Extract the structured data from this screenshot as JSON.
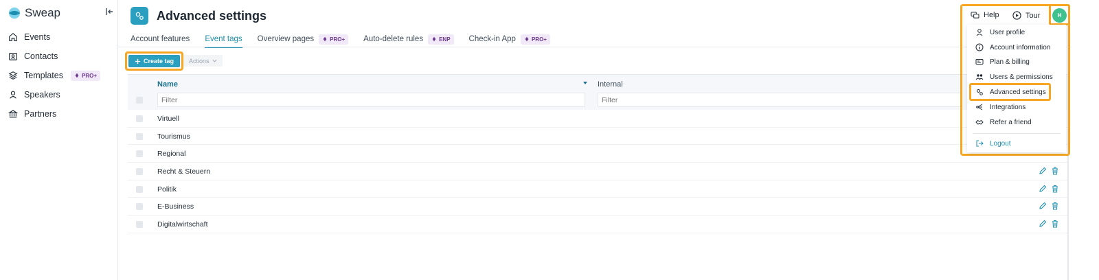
{
  "brand": {
    "name": "Sweap"
  },
  "sidebar": {
    "items": [
      {
        "label": "Events",
        "icon": "home-icon"
      },
      {
        "label": "Contacts",
        "icon": "contacts-icon"
      },
      {
        "label": "Templates",
        "icon": "layers-icon",
        "badge": "PRO+"
      },
      {
        "label": "Speakers",
        "icon": "speaker-icon"
      },
      {
        "label": "Partners",
        "icon": "bank-icon"
      }
    ]
  },
  "page": {
    "title": "Advanced settings"
  },
  "tabs": [
    {
      "label": "Account features",
      "active": false
    },
    {
      "label": "Event tags",
      "active": true
    },
    {
      "label": "Overview pages",
      "badge": "PRO+"
    },
    {
      "label": "Auto-delete rules",
      "badge": "ENP"
    },
    {
      "label": "Check-in App",
      "badge": "PRO+"
    }
  ],
  "toolbar": {
    "create_label": "Create tag",
    "actions_label": "Actions"
  },
  "table": {
    "columns": {
      "name": "Name",
      "internal": "Internal"
    },
    "filter_placeholder": "Filter",
    "rows": [
      "Virtuell",
      "Tourismus",
      "Regional",
      "Recht & Steuern",
      "Politik",
      "E-Business",
      "Digitalwirtschaft"
    ]
  },
  "topbar": {
    "help": "Help",
    "tour": "Tour",
    "avatar_initial": "H"
  },
  "user_menu": {
    "items": [
      {
        "label": "User profile",
        "icon": "user-icon"
      },
      {
        "label": "Account information",
        "icon": "info-icon"
      },
      {
        "label": "Plan & billing",
        "icon": "id-card-icon"
      },
      {
        "label": "Users & permissions",
        "icon": "users-icon"
      },
      {
        "label": "Advanced settings",
        "icon": "gears-icon"
      },
      {
        "label": "Integrations",
        "icon": "integrations-icon"
      },
      {
        "label": "Refer a friend",
        "icon": "handshake-icon"
      }
    ],
    "logout": "Logout"
  },
  "colors": {
    "accent": "#2a9fbf",
    "highlight": "#f6a623",
    "avatar": "#3fc28d",
    "pro_badge": "#f1e8f8"
  }
}
